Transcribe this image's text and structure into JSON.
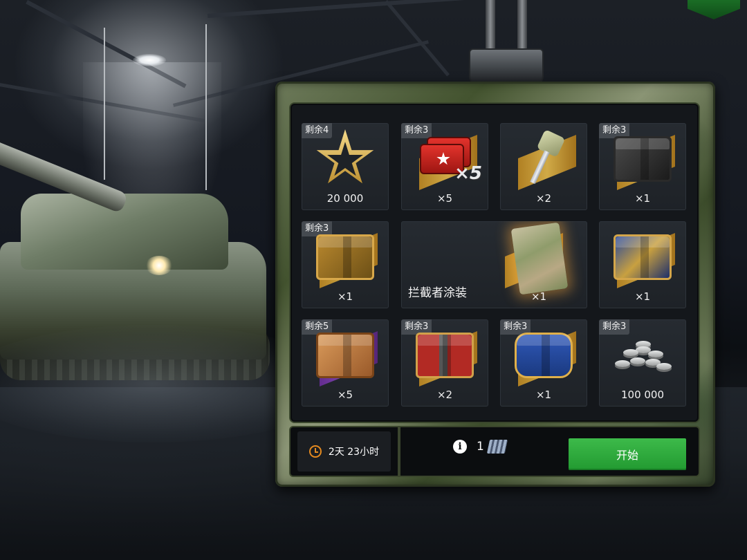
{
  "cells": [
    {
      "badge": "剩余4",
      "qty": "20 000",
      "item": "gold-star"
    },
    {
      "badge": "剩余3",
      "qty": "×5",
      "item": "red-cards",
      "overlay": "×5"
    },
    {
      "badge": "",
      "qty": "×2",
      "item": "key"
    },
    {
      "badge": "剩余3",
      "qty": "×1",
      "item": "black-crate"
    },
    {
      "badge": "剩余3",
      "qty": "×1",
      "item": "gold-crate"
    },
    {
      "badge": "",
      "qty": "×1",
      "item": "camouflage-map",
      "label": "拦截者涂装"
    },
    {
      "badge": "",
      "qty": "×1",
      "item": "cosmic-crate"
    },
    {
      "badge": "剩余5",
      "qty": "×5",
      "item": "wood-crate"
    },
    {
      "badge": "剩余3",
      "qty": "×2",
      "item": "red-crate"
    },
    {
      "badge": "剩余3",
      "qty": "×1",
      "item": "blue-crate"
    },
    {
      "badge": "剩余3",
      "qty": "100 000",
      "item": "silver-coins"
    }
  ],
  "bottom": {
    "timer": "2天 23小时",
    "ticket_count": "1",
    "start_label": "开始"
  },
  "icons": {
    "timer": "clock-icon",
    "info": "info-icon",
    "ticket": "ticket-icon"
  },
  "colors": {
    "start_button": "#2aa539",
    "clock": "#e58a1f",
    "ribbon": "#d6a53a"
  }
}
